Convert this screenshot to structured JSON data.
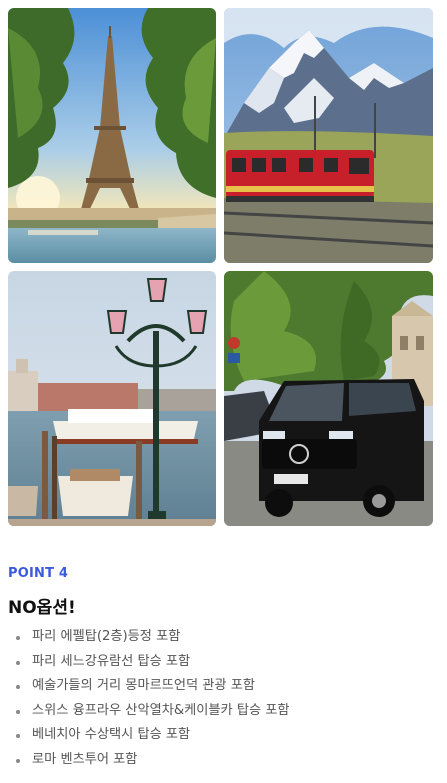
{
  "section": {
    "point_label": "POINT 4",
    "title": "NO옵션!",
    "items": [
      "파리 에펠탑(2층)등정 포함",
      "파리 세느강유람선 탑승 포함",
      "예술가들의 거리 몽마르뜨언덕 관광 포함",
      "스위스 융프라우 산악열차&케이블카 탑승 포함",
      "베네치아 수상택시 탑승 포함",
      "로마 벤츠투어 포함"
    ]
  },
  "photos": [
    "eiffel-tower",
    "swiss-mountain-train",
    "venice-lamp-boats",
    "mercedes-van-rome"
  ],
  "colors": {
    "accent": "#3b5bdb",
    "train_red": "#c8202a"
  }
}
